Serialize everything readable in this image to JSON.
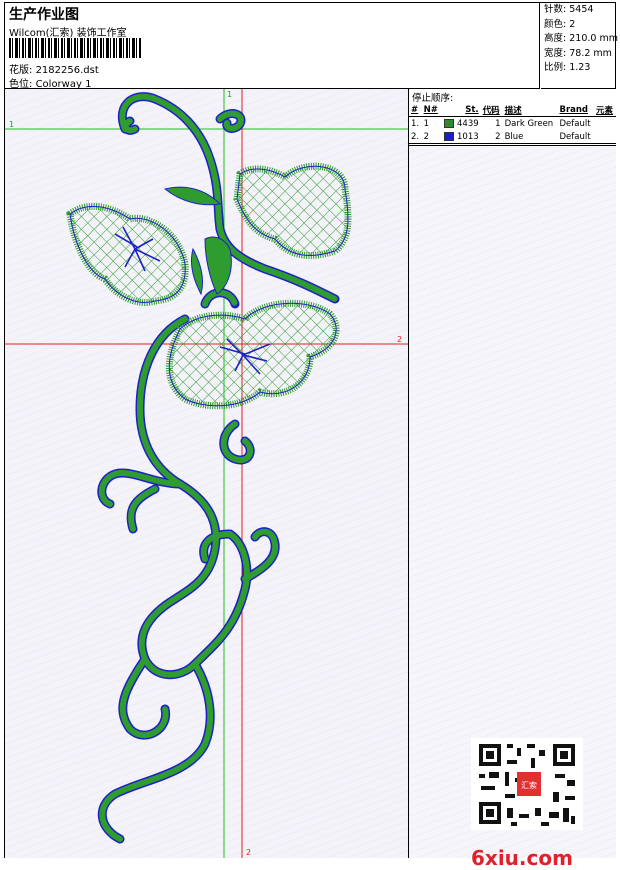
{
  "header": {
    "title": "生产作业图",
    "company": "Wilcom(汇索) 装饰工作室",
    "file_label": "花版:",
    "file_value": "2182256.dst",
    "colorway_label": "色位:",
    "colorway_value": "Colorway 1"
  },
  "stats": {
    "stitches_label": "针数:",
    "stitches": "5454",
    "colors_label": "颜色:",
    "colors": "2",
    "height_label": "高度:",
    "height": "210.0 mm",
    "width_label": "宽度:",
    "width": "78.2 mm",
    "scale_label": "比例:",
    "scale": "1.23"
  },
  "panel": {
    "heading": "停止顺序:",
    "columns": [
      "#",
      "N#",
      "St.",
      "代码",
      "描述",
      "Brand",
      "元素"
    ],
    "rows": [
      {
        "num": "1.",
        "n": "1",
        "color": "#2e8b2e",
        "st": "4439",
        "code": "1",
        "desc": "Dark Green",
        "brand": "Default"
      },
      {
        "num": "2.",
        "n": "2",
        "color": "#1c1cc8",
        "st": "1013",
        "code": "2",
        "desc": "Blue",
        "brand": "Default"
      }
    ]
  },
  "design": {
    "guide_labels": [
      "1",
      "2",
      "1",
      "2"
    ],
    "colors": {
      "green": "#2e9c2e",
      "blue": "#2020c8",
      "guide_red": "#e02020",
      "guide_green": "#20c020"
    }
  },
  "watermark": {
    "text": "6xiu.com",
    "seal": "汇索"
  }
}
